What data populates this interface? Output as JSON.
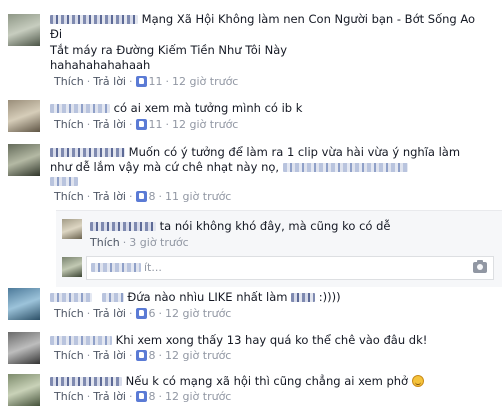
{
  "actions": {
    "like": "Thích",
    "reply": "Trả lời"
  },
  "comments": [
    {
      "line1": "Mạng Xã Hội Không làm nen Con Người bạn - Bớt Sống Ao",
      "line2": "Đi",
      "line3": "Tắt máy ra Đường Kiếm Tiền Như Tôi Này",
      "line4": "hahahahahahaah",
      "likes": "11",
      "time": "12 giờ trước"
    },
    {
      "line1": "có ai xem mà tưởng mình có ib k",
      "likes": "11",
      "time": "12 giờ trước"
    },
    {
      "line1": "Muốn có ý tưởng để làm ra 1 clip vừa hài vừa ý nghĩa làm",
      "line2": "như dễ lắm vậy mà cứ chê nhạt này nọ,",
      "likes": "8",
      "time": "11 giờ trước"
    },
    {
      "line1": "ta nói không khó đây, mà cũng ko có dễ",
      "time": "3 giờ trước"
    },
    {
      "line1": "Đứa nào nhìu LIKE nhất làm",
      "line1_tail": ":))))",
      "likes": "6",
      "time": "12 giờ trước"
    },
    {
      "line1": "Khi xem xong thấy 13 hay quá ko thể chê vào đâu dk!",
      "likes": "8",
      "time": "12 giờ trước"
    },
    {
      "line1": "Nếu k có mạng xã hội thì cũng chẳng ai xem phở",
      "likes": "8",
      "time": "12 giờ trước"
    }
  ],
  "write_reply": {
    "placeholder_visible": "ít..."
  },
  "icons": {
    "like": "like-thumb-icon",
    "camera": "camera-icon",
    "emoji": "emoji-icon"
  },
  "colors": {
    "link": "#4e5665",
    "meta": "#9197a3",
    "like_blue": "#5b7bd5",
    "reply_bg": "#f6f7f9"
  }
}
